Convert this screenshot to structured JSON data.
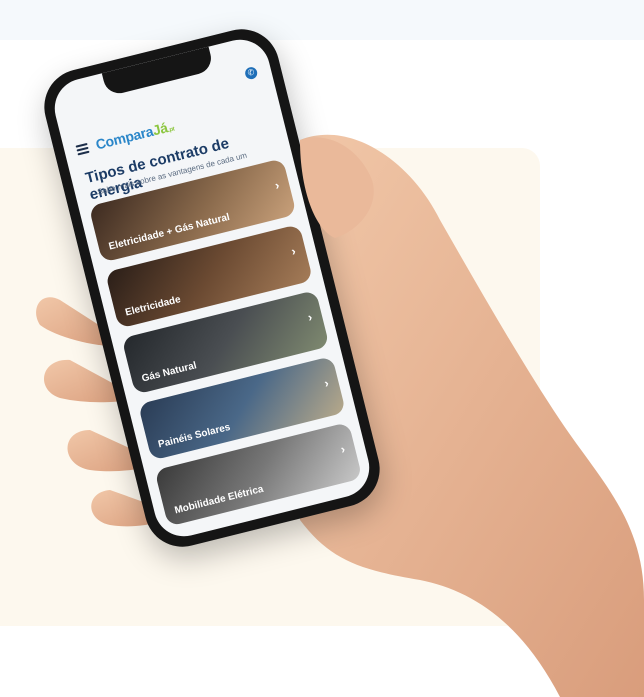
{
  "app": {
    "logo": "Compara",
    "logo_accent": "Já",
    "logo_suffix": ".pt"
  },
  "page": {
    "title": "Tipos de contrato de energia",
    "subtitle": "Sabe mais sobre as vantagens de cada um"
  },
  "icons": {
    "menu": "hamburger-menu-icon",
    "call": "phone-call-icon",
    "arrow": "chevron-right-icon"
  },
  "cards": [
    {
      "label": "Eletricidade + Gás Natural"
    },
    {
      "label": "Eletricidade"
    },
    {
      "label": "Gás Natural"
    },
    {
      "label": "Painéis Solares"
    },
    {
      "label": "Mobilidade Elétrica"
    }
  ],
  "colors": {
    "brand_blue": "#2a86c9",
    "brand_green": "#8cc63f",
    "title_navy": "#1c3c66"
  }
}
